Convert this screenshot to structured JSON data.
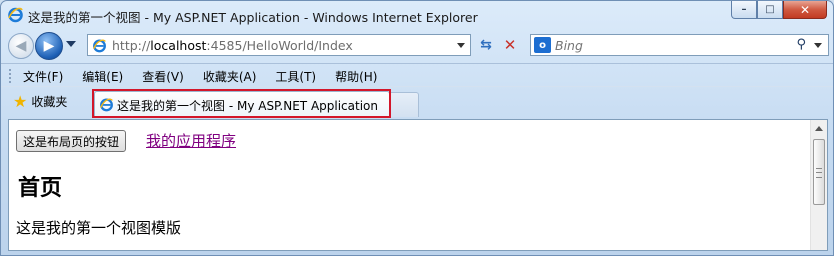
{
  "window": {
    "title": "这是我的第一个视图 - My ASP.NET Application - Windows Internet Explorer",
    "controls": {
      "minimize": "–",
      "maximize": "□",
      "close": "✕"
    }
  },
  "navigation": {
    "address": {
      "prefix": "http://",
      "host": "localhost",
      "rest": ":4585/HelloWorld/Index"
    },
    "search": {
      "provider_icon": "outlook-icon",
      "placeholder": "Bing"
    }
  },
  "menu": {
    "items": [
      "文件(F)",
      "编辑(E)",
      "查看(V)",
      "收藏夹(A)",
      "工具(T)",
      "帮助(H)"
    ]
  },
  "favorites": {
    "label": "收藏夹"
  },
  "tabs": [
    {
      "label": "这是我的第一个视图 - My ASP.NET Application",
      "active": true
    }
  ],
  "page": {
    "layout_button": "这是布局页的按钮",
    "app_link": "我的应用程序",
    "heading": "首页",
    "body": "这是我的第一个视图模版"
  },
  "colors": {
    "highlight": "#d3162a",
    "visited_link": "#800080",
    "chrome": "#cfe0f1"
  }
}
